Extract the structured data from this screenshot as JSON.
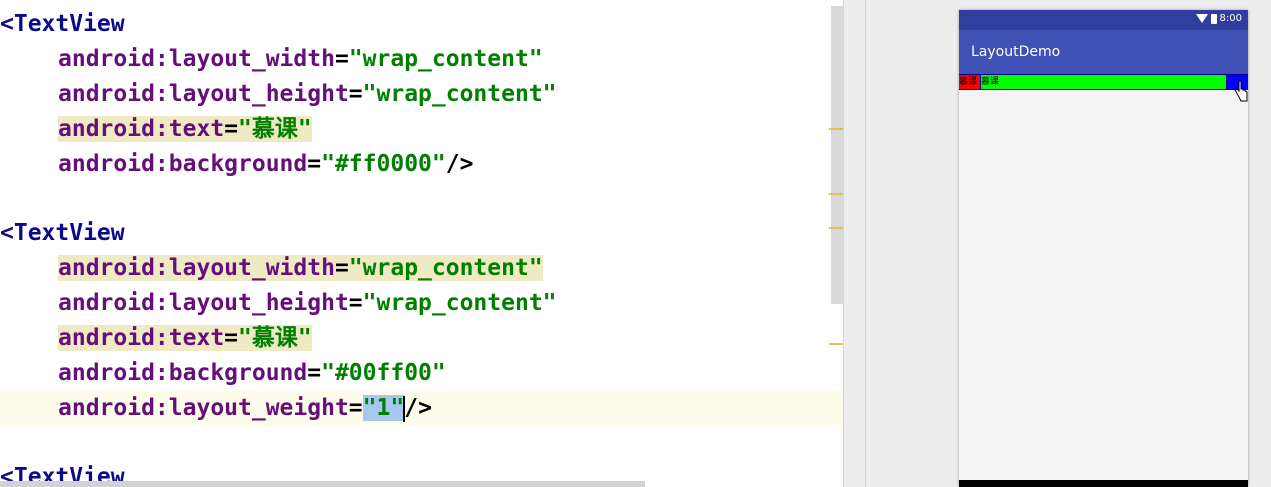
{
  "editor": {
    "lines": [
      {
        "tag": "<TextView"
      },
      {
        "attr": "android:layout_width",
        "eq": "=",
        "value": "\"wrap_content\""
      },
      {
        "attr": "android:layout_height",
        "eq": "=",
        "value": "\"wrap_content\""
      },
      {
        "attr": "android:text",
        "eq": "=",
        "value": "\"慕课\""
      },
      {
        "attr": "android:background",
        "eq": "=",
        "value": "\"#ff0000\"",
        "end": "/>"
      },
      {
        "tag": "<TextView"
      },
      {
        "attr": "android:layout_width",
        "eq": "=",
        "value": "\"wrap_content\""
      },
      {
        "attr": "android:layout_height",
        "eq": "=",
        "value": "\"wrap_content\""
      },
      {
        "attr": "android:text",
        "eq": "=",
        "value": "\"慕课\""
      },
      {
        "attr": "android:background",
        "eq": "=",
        "value": "\"#00ff00\""
      },
      {
        "attr": "android:layout_weight",
        "eq": "=",
        "q1": "\"",
        "sel": "1",
        "q2": "\"",
        "end": "/>"
      },
      {
        "tag": "<TextView"
      }
    ]
  },
  "preview": {
    "status_time": "8:00",
    "app_title": "LayoutDemo",
    "textview_red_text": "慕课",
    "textview_green_text": "慕课",
    "colors": {
      "status_bar": "#303f9f",
      "app_bar": "#3f51b5",
      "textview_red": "#ff0000",
      "textview_green": "#00ff00",
      "textview_blue": "#0000ff"
    }
  }
}
